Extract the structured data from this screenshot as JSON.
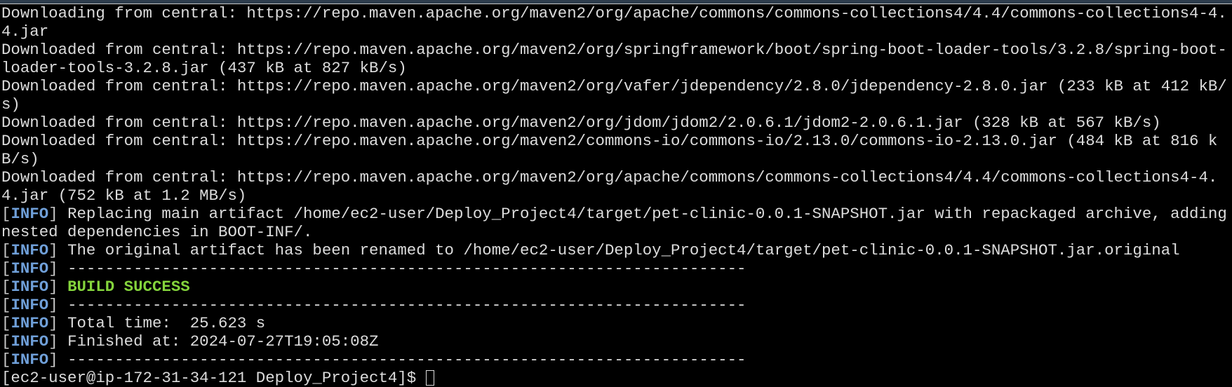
{
  "colors": {
    "background": "#000000",
    "text": "#dcdcdc",
    "info": "#6f9fd8",
    "success": "#84d43c"
  },
  "info_tag": "INFO",
  "lines": [
    "Downloading from central: https://repo.maven.apache.org/maven2/org/apache/commons/commons-collections4/4.4/commons-collections4-4.4.jar",
    "Downloaded from central: https://repo.maven.apache.org/maven2/org/springframework/boot/spring-boot-loader-tools/3.2.8/spring-boot-loader-tools-3.2.8.jar (437 kB at 827 kB/s)",
    "Downloaded from central: https://repo.maven.apache.org/maven2/org/vafer/jdependency/2.8.0/jdependency-2.8.0.jar (233 kB at 412 kB/s)",
    "Downloaded from central: https://repo.maven.apache.org/maven2/org/jdom/jdom2/2.0.6.1/jdom2-2.0.6.1.jar (328 kB at 567 kB/s)",
    "Downloaded from central: https://repo.maven.apache.org/maven2/commons-io/commons-io/2.13.0/commons-io-2.13.0.jar (484 kB at 816 kB/s)",
    "Downloaded from central: https://repo.maven.apache.org/maven2/org/apache/commons/commons-collections4/4.4/commons-collections4-4.4.jar (752 kB at 1.2 MB/s)"
  ],
  "info_lines": {
    "replacing": "Replacing main artifact /home/ec2-user/Deploy_Project4/target/pet-clinic-0.0.1-SNAPSHOT.jar with repackaged archive, adding nested dependencies in BOOT-INF/.",
    "renamed": "The original artifact has been renamed to /home/ec2-user/Deploy_Project4/target/pet-clinic-0.0.1-SNAPSHOT.jar.original",
    "separator": "------------------------------------------------------------------------",
    "build_status": "BUILD SUCCESS",
    "total_time": "Total time:  25.623 s",
    "finished_at": "Finished at: 2024-07-27T19:05:08Z"
  },
  "prompt": "[ec2-user@ip-172-31-34-121 Deploy_Project4]$ "
}
